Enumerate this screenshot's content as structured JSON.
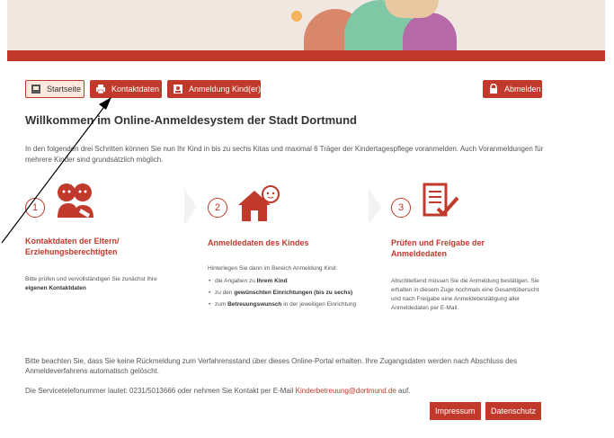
{
  "nav": {
    "home_label": "Startseite",
    "contact_label": "Kontaktdaten",
    "register_label": "Anmeldung Kind(er)",
    "logout_label": "Abmelden"
  },
  "title": "Willkommen im Online-Anmeldesystem der Stadt Dortmund",
  "intro": "In den folgenden drei Schritten können Sie nun Ihr Kind in bis zu sechs Kitas und maximal 6 Träger der Kindertagespflege voranmelden. Auch Voranmeldungen für mehrere Kinder sind grundsätzlich möglich.",
  "steps": [
    {
      "number": "1",
      "icon": "parents-contact-icon",
      "title": "Kontaktdaten der Eltern/ Erziehungsberechtigten",
      "text_plain": "Bitte prüfen und vervollständigen Sie zunächst Ihre",
      "text_bold": "eigenen Kontaktdaten"
    },
    {
      "number": "2",
      "icon": "child-house-icon",
      "title": "Anmeldedaten des Kindes",
      "text_plain": "Hinterlegen Sie dann im Bereich Anmeldung Kind:",
      "bullets": [
        {
          "plain": "die Angaben zu ",
          "bold": "Ihrem Kind",
          "after": ""
        },
        {
          "plain": "zu den ",
          "bold": "gewünschten Einrichtungen (bis zu sechs)",
          "after": ""
        },
        {
          "plain": "zum ",
          "bold": "Betreuungswunsch",
          "after": " in der jeweiligen Einrichtung"
        }
      ]
    },
    {
      "number": "3",
      "icon": "document-check-icon",
      "title": "Prüfen und Freigabe der Anmeldedaten",
      "text_plain": "Abschließend müssen Sie die Anmeldung bestätigen. Sie erhalten in diesem Zuge nochmals eine Gesamtübersicht und nach Freigabe eine Anmeldebestätigung aller Anmeldedaten per E-Mail."
    }
  ],
  "note": "Bitte beachten Sie, dass Sie keine Rückmeldung zum Verfahrensstand über dieses Online-Portal erhalten. Ihre Zugangsdaten werden nach Abschluss des Anmeldeverfahrens automatisch gelöscht.",
  "contact": {
    "before": "Die Servicetelefonummer lautet: 0231/5013666 oder nehmen Sie Kontakt per E-Mail ",
    "email": "Kinderbetreuung@dortmund.de",
    "after": " auf."
  },
  "footer": {
    "impressum_label": "Impressum",
    "privacy_label": "Datenschutz"
  },
  "colors": {
    "accent": "#c0392b",
    "banner_bg": "#f0e7e0"
  }
}
